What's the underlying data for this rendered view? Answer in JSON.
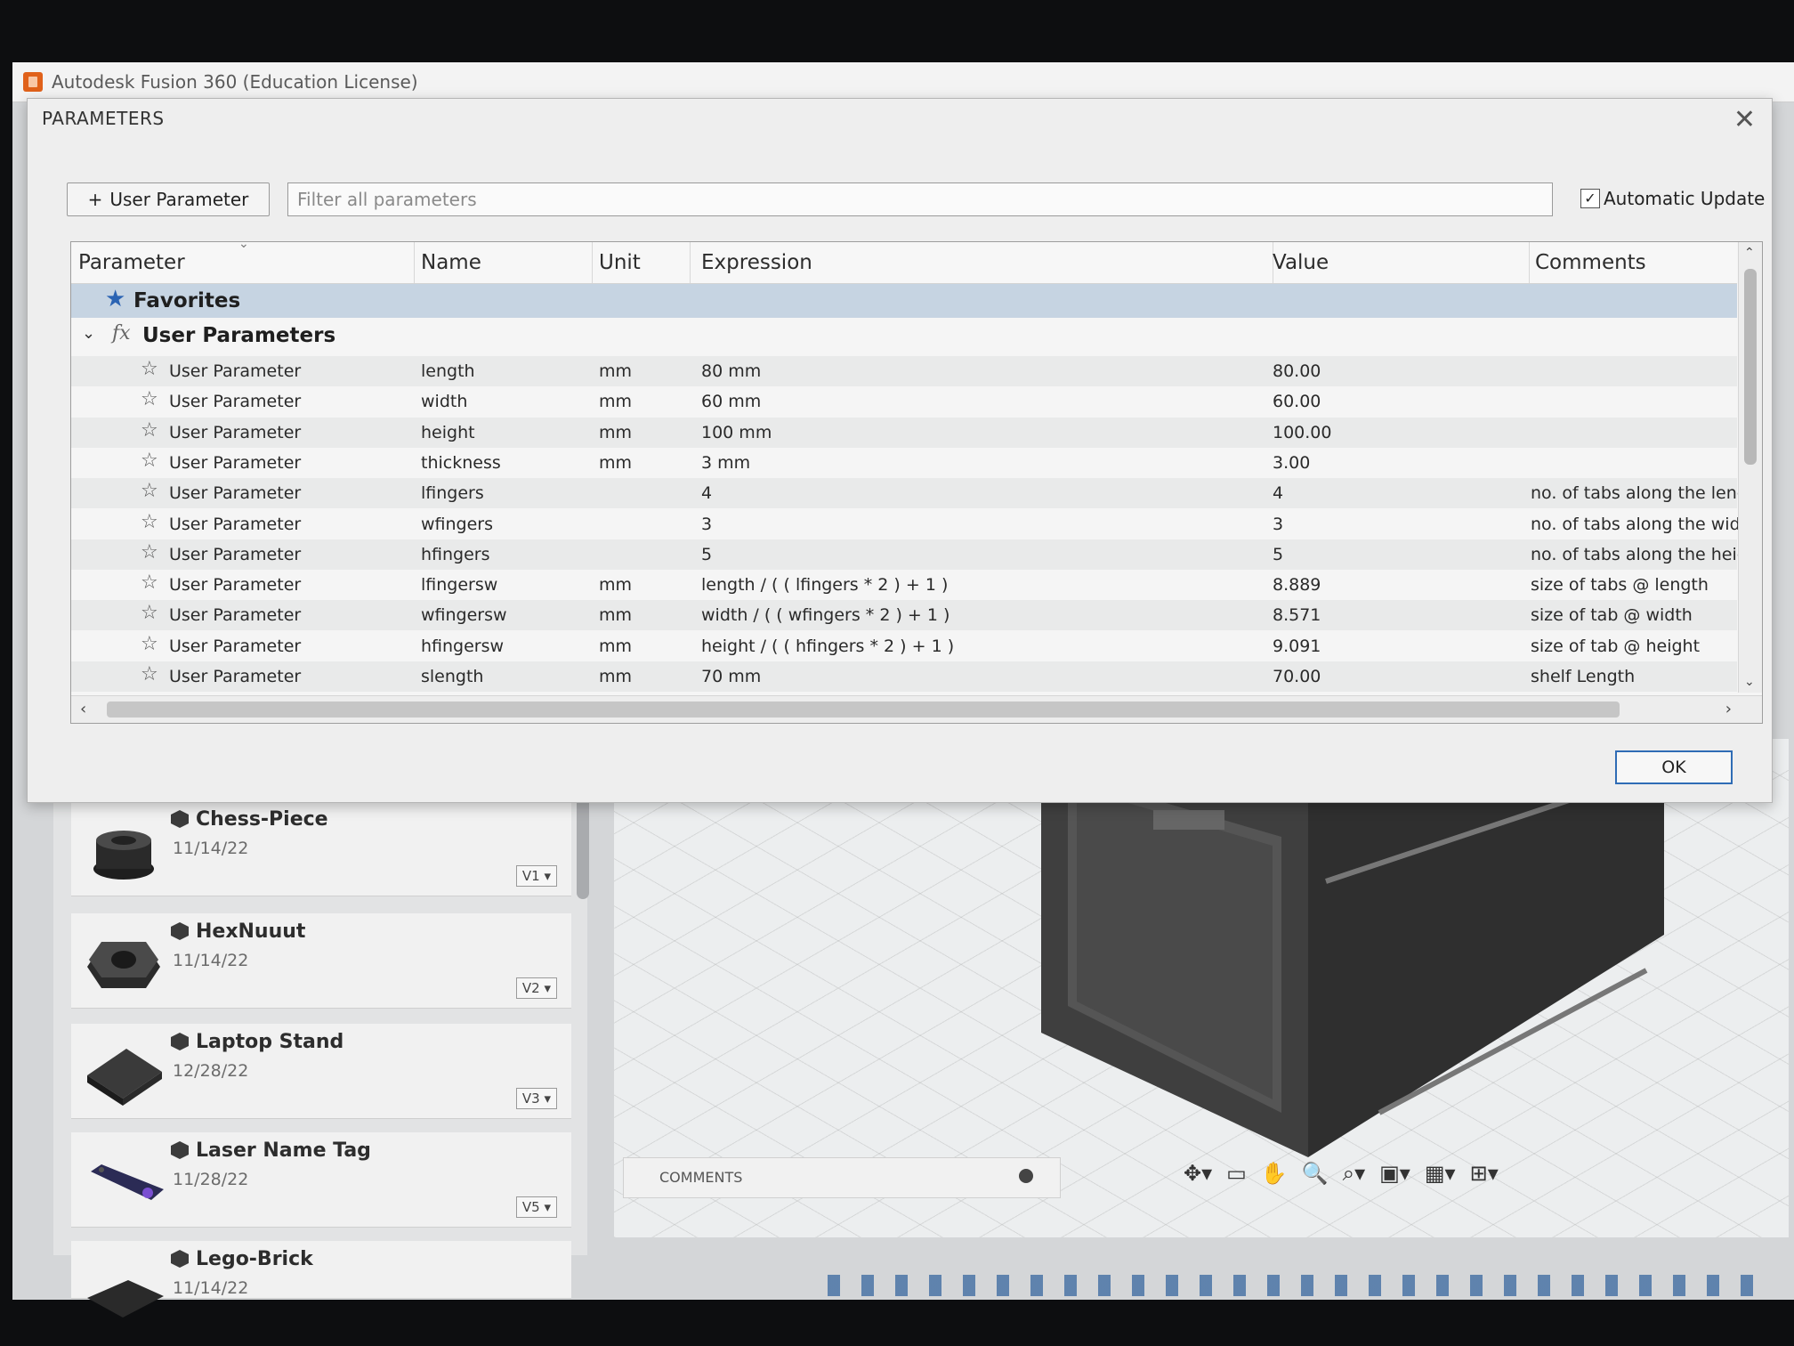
{
  "app": {
    "title": "Autodesk Fusion 360 (Education License)"
  },
  "dialog": {
    "title": "PARAMETERS",
    "add_button_label": "User Parameter",
    "filter_placeholder": "Filter all parameters",
    "auto_update_label": "Automatic Update",
    "auto_update_checked": true,
    "ok_label": "OK",
    "columns": [
      "Parameter",
      "Name",
      "Unit",
      "Expression",
      "Value",
      "Comments"
    ],
    "favorites_label": "Favorites",
    "group_label": "User Parameters",
    "rows": [
      {
        "parameter": "User Parameter",
        "name": "length",
        "unit": "mm",
        "expression": "80 mm",
        "value": "80.00",
        "comment": ""
      },
      {
        "parameter": "User Parameter",
        "name": "width",
        "unit": "mm",
        "expression": "60 mm",
        "value": "60.00",
        "comment": ""
      },
      {
        "parameter": "User Parameter",
        "name": "height",
        "unit": "mm",
        "expression": "100 mm",
        "value": "100.00",
        "comment": ""
      },
      {
        "parameter": "User Parameter",
        "name": "thickness",
        "unit": "mm",
        "expression": "3 mm",
        "value": "3.00",
        "comment": ""
      },
      {
        "parameter": "User Parameter",
        "name": "lfingers",
        "unit": "",
        "expression": "4",
        "value": "4",
        "comment": "no. of tabs along the leng"
      },
      {
        "parameter": "User Parameter",
        "name": "wfingers",
        "unit": "",
        "expression": "3",
        "value": "3",
        "comment": "no. of tabs along the widt"
      },
      {
        "parameter": "User Parameter",
        "name": "hfingers",
        "unit": "",
        "expression": "5",
        "value": "5",
        "comment": "no. of tabs along the heig"
      },
      {
        "parameter": "User Parameter",
        "name": "lfingersw",
        "unit": "mm",
        "expression": "length / ( ( lfingers * 2 ) + 1 )",
        "value": "8.889",
        "comment": "size of tabs @ length"
      },
      {
        "parameter": "User Parameter",
        "name": "wfingersw",
        "unit": "mm",
        "expression": "width / ( ( wfingers * 2 ) + 1 )",
        "value": "8.571",
        "comment": "size of tab @ width"
      },
      {
        "parameter": "User Parameter",
        "name": "hfingersw",
        "unit": "mm",
        "expression": "height / ( ( hfingers * 2 ) + 1 )",
        "value": "9.091",
        "comment": "size of tab @ height"
      },
      {
        "parameter": "User Parameter",
        "name": "slength",
        "unit": "mm",
        "expression": "70 mm",
        "value": "70.00",
        "comment": "shelf Length"
      }
    ]
  },
  "data_panel": {
    "items": [
      {
        "name": "Chess-Piece",
        "date": "11/14/22",
        "version": "V1"
      },
      {
        "name": "HexNuuut",
        "date": "11/14/22",
        "version": "V2"
      },
      {
        "name": "Laptop Stand",
        "date": "12/28/22",
        "version": "V3"
      },
      {
        "name": "Laser Name Tag",
        "date": "11/28/22",
        "version": "V5"
      },
      {
        "name": "Lego-Brick",
        "date": "11/14/22",
        "version": ""
      }
    ]
  },
  "viewport": {
    "comments_label": "COMMENTS"
  }
}
